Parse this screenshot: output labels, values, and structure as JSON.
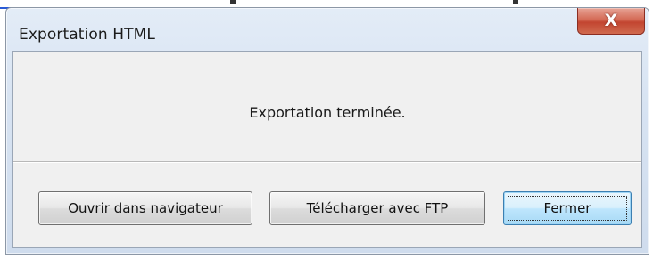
{
  "dialog": {
    "title": "Exportation HTML",
    "close_icon": "close-icon",
    "message": "Exportation terminée.",
    "buttons": {
      "open_in_browser": "Ouvrir dans navigateur",
      "upload_ftp": "Télécharger avec FTP",
      "close": "Fermer"
    },
    "default_button": "close"
  },
  "colors": {
    "close_button": "#c24530",
    "default_button_border": "#3c7fb1",
    "client_background": "#f0f0f0",
    "frame": "#d7e3f2"
  }
}
